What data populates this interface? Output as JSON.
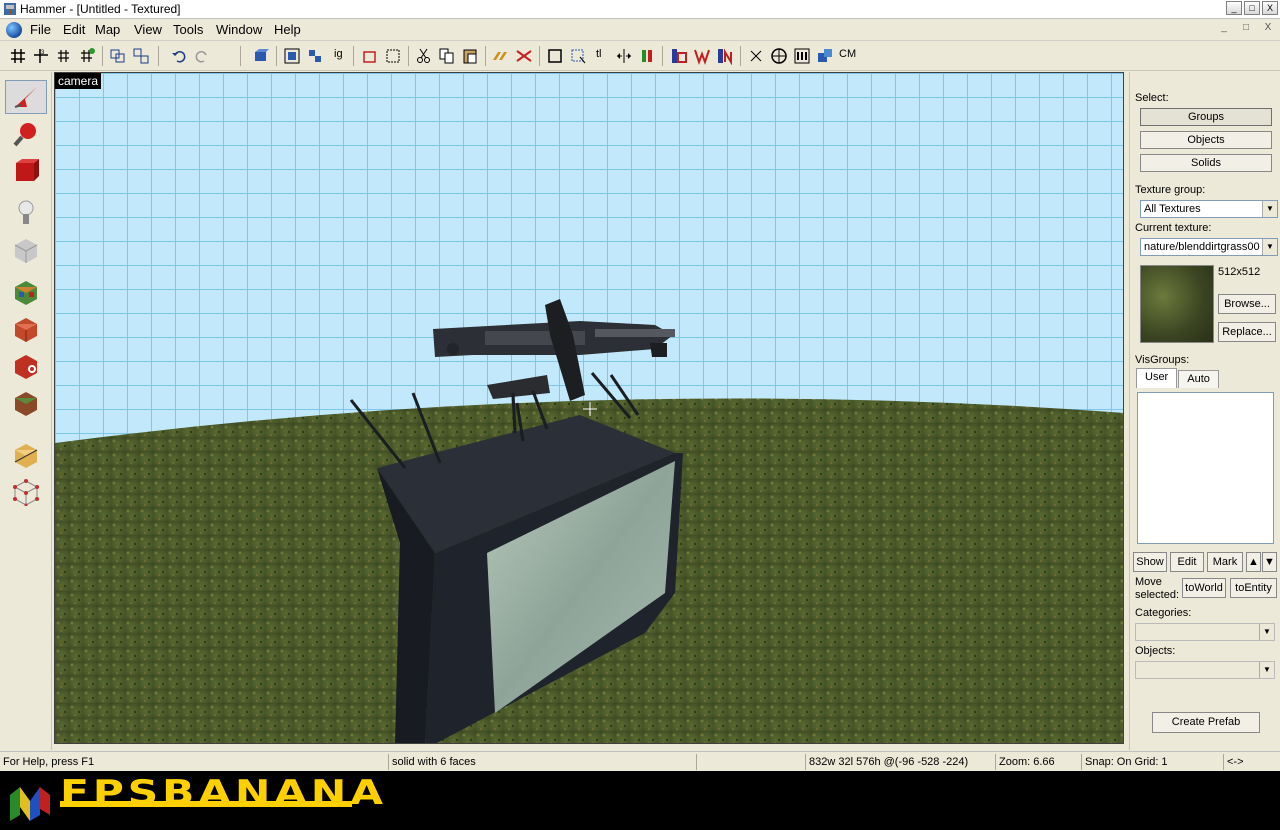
{
  "window": {
    "title": "Hammer - [Untitled - Textured]",
    "controls": [
      "_",
      "□",
      "X"
    ]
  },
  "menu": {
    "items": [
      "File",
      "Edit",
      "Map",
      "View",
      "Tools",
      "Window",
      "Help"
    ],
    "mdi_controls": [
      "_",
      "□",
      "X"
    ]
  },
  "toolbar": {
    "text_buttons": {
      "tl": "tl",
      "cm": "CM",
      "ig": "ig"
    }
  },
  "tools": [
    {
      "name": "selection-tool",
      "color": "#d02020"
    },
    {
      "name": "magnify-tool",
      "color": "#d02020"
    },
    {
      "name": "camera-tool",
      "color": "#c01818"
    },
    {
      "name": "entity-tool",
      "color": "#a0a0a0"
    },
    {
      "name": "block-tool",
      "color": "#b8b8b8"
    },
    {
      "name": "texture-application-tool",
      "color": "#4a8a3a"
    },
    {
      "name": "apply-current-texture-tool",
      "color": "#c04a2a"
    },
    {
      "name": "decal-tool",
      "color": "#c03020"
    },
    {
      "name": "overlay-tool",
      "color": "#5a7a3a"
    },
    {
      "name": "clipping-tool",
      "color": "#e0b050"
    },
    {
      "name": "vertex-tool",
      "color": "#c03030"
    }
  ],
  "viewport": {
    "label": "camera",
    "sky_color": "#c2e9fb",
    "ground_color": "#4b5a2a"
  },
  "rightpanel": {
    "select_label": "Select:",
    "select_buttons": [
      "Groups",
      "Objects",
      "Solids"
    ],
    "texture_group_label": "Texture group:",
    "texture_group_value": "All Textures",
    "current_texture_label": "Current texture:",
    "current_texture_value": "nature/blenddirtgrass00",
    "texture_size": "512x512",
    "browse_button": "Browse...",
    "replace_button": "Replace...",
    "visgroups_label": "VisGroups:",
    "visgroup_tabs": [
      "User",
      "Auto"
    ],
    "show_button": "Show",
    "edit_button": "Edit",
    "mark_button": "Mark",
    "move_selected_label_1": "Move",
    "move_selected_label_2": "selected:",
    "to_world_button": "toWorld",
    "to_entity_button": "toEntity",
    "categories_label": "Categories:",
    "objects_label": "Objects:",
    "create_prefab_button": "Create Prefab"
  },
  "statusbar": {
    "help": "For Help, press F1",
    "selection": "solid with 6 faces",
    "size": "832w 32l 576h @(-96 -528 -224)",
    "zoom": "Zoom: 6.66",
    "snap": "Snap: On Grid: 1",
    "extra": "<->"
  },
  "banner": {
    "text": "FPSBANANA",
    "color": "#ffd000"
  }
}
